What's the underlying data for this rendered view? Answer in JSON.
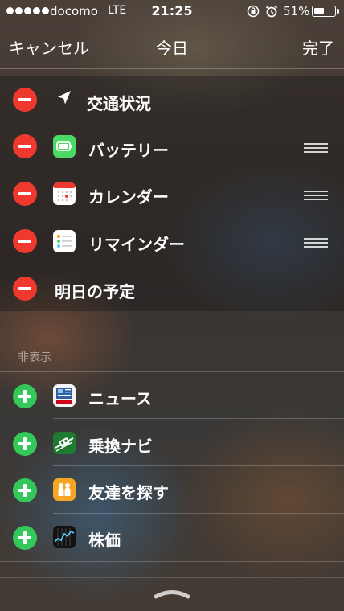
{
  "status_bar": {
    "carrier": "docomo",
    "network": "LTE",
    "time": "21:25",
    "battery_percent": "51%",
    "battery_level": 0.51
  },
  "nav": {
    "cancel_label": "キャンセル",
    "title": "今日",
    "done_label": "完了"
  },
  "shown_widgets": [
    {
      "label": "交通状況",
      "icon": "location-arrow-icon",
      "reorder": false
    },
    {
      "label": "バッテリー",
      "icon": "battery-app-icon",
      "reorder": true
    },
    {
      "label": "カレンダー",
      "icon": "calendar-app-icon",
      "reorder": true
    },
    {
      "label": "リマインダー",
      "icon": "reminders-app-icon",
      "reorder": true
    },
    {
      "label": "明日の予定",
      "icon": "",
      "reorder": false
    }
  ],
  "hidden_section": {
    "header": "非表示",
    "widgets": [
      {
        "label": "ニュース",
        "icon": "yahoo-news-app-icon"
      },
      {
        "label": "乗換ナビ",
        "icon": "transit-navi-app-icon"
      },
      {
        "label": "友達を探す",
        "icon": "find-friends-app-icon"
      },
      {
        "label": "株価",
        "icon": "stocks-app-icon"
      }
    ]
  },
  "colors": {
    "remove": "#f0392e",
    "add": "#34c759"
  }
}
